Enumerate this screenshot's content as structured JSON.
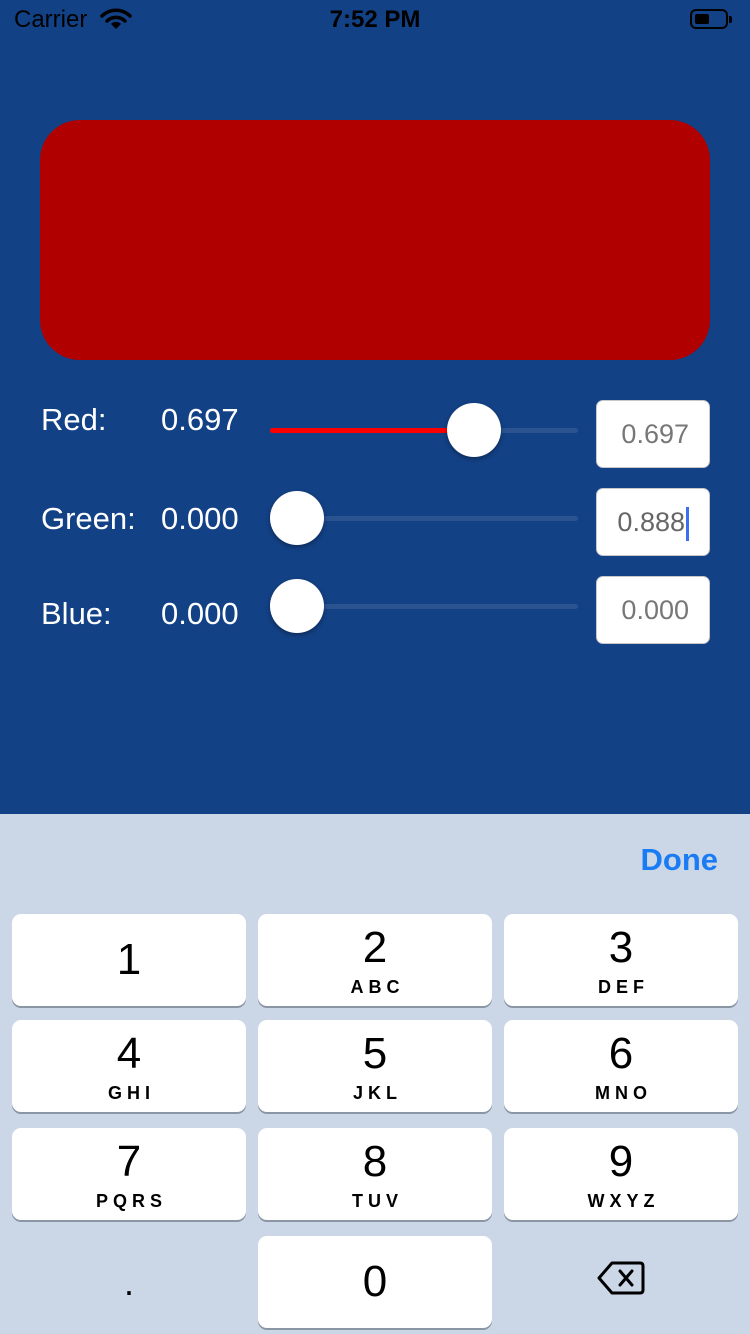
{
  "status_bar": {
    "carrier": "Carrier",
    "time": "7:52 PM"
  },
  "swatch": {
    "color": "#b10000"
  },
  "sliders": [
    {
      "label": "Red:",
      "value_text": "0.697",
      "value": 0.697,
      "field_text": "0.697",
      "fill_color": "#ff0000"
    },
    {
      "label": "Green:",
      "value_text": "0.000",
      "value": 0.0,
      "field_text": "0.888"
    },
    {
      "label": "Blue:",
      "value_text": "0.000",
      "value": 0.0,
      "field_text": "0.000"
    }
  ],
  "keyboard": {
    "done_label": "Done",
    "keys": [
      {
        "num": "1",
        "letters": ""
      },
      {
        "num": "2",
        "letters": "ABC"
      },
      {
        "num": "3",
        "letters": "DEF"
      },
      {
        "num": "4",
        "letters": "GHI"
      },
      {
        "num": "5",
        "letters": "JKL"
      },
      {
        "num": "6",
        "letters": "MNO"
      },
      {
        "num": "7",
        "letters": "PQRS"
      },
      {
        "num": "8",
        "letters": "TUV"
      },
      {
        "num": "9",
        "letters": "WXYZ"
      },
      {
        "num": "0",
        "letters": ""
      }
    ],
    "decimal": ".",
    "delete_icon": "backspace-icon"
  },
  "colors": {
    "background": "#134185",
    "accent": "#1a7cf5"
  }
}
